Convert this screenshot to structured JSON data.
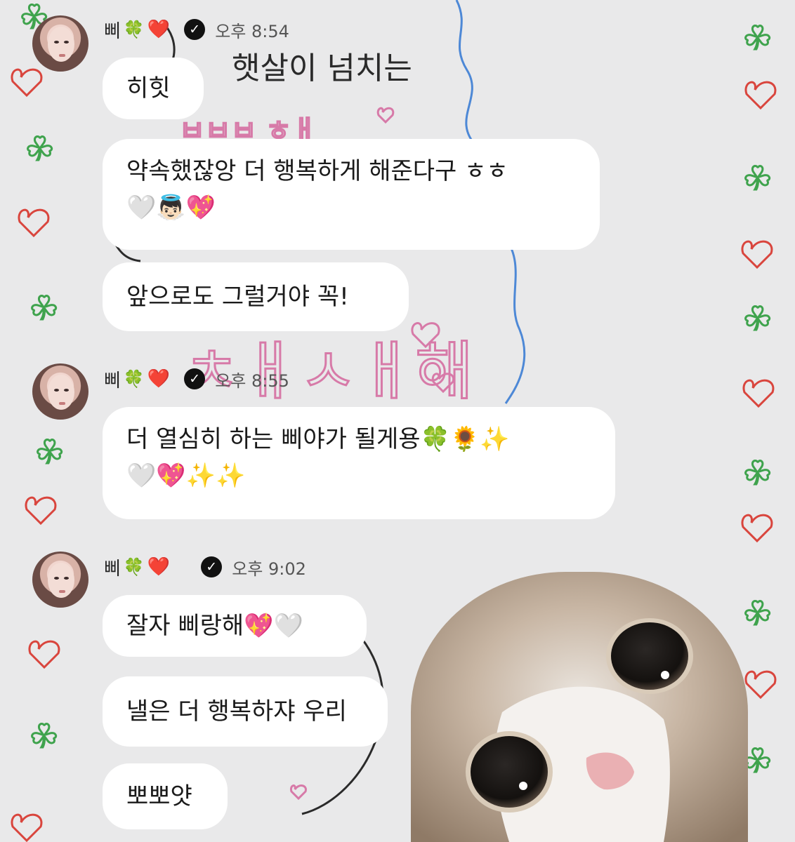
{
  "sender": {
    "name": "삐",
    "clover_icon": "🍀",
    "heart_icon": "❤️"
  },
  "groups": [
    {
      "time": "오후 8:54",
      "messages": [
        {
          "lines": [
            "히힛"
          ]
        },
        {
          "lines": [
            "약속했잖앙 더 행복하게 해준다구 ㅎㅎ",
            "🤍👼🏻💖"
          ]
        },
        {
          "lines": [
            "앞으로도 그럴거야 꼭!"
          ]
        }
      ]
    },
    {
      "time": "오후 8:55",
      "messages": [
        {
          "lines": [
            "더 열심히 하는 삐야가 될게용🍀🌻✨",
            "🤍💖✨✨"
          ]
        }
      ]
    },
    {
      "time": "오후 9:02",
      "messages": [
        {
          "lines": [
            "잘자 삐랑해💖🤍"
          ]
        },
        {
          "lines": [
            "낼은 더 행복하쟈 우리"
          ]
        },
        {
          "lines": [
            "뽀뽀얏"
          ]
        }
      ]
    }
  ],
  "wallpaper": {
    "handwritten_lines": [
      "햇살이 넘치는"
    ]
  },
  "colors": {
    "bubble": "#ffffff",
    "background": "#e9e9ea",
    "doodle_green": "#3fa34d",
    "doodle_red": "#d9453d",
    "doodle_pink": "#d77aa8",
    "doodle_blue": "#4d88d6"
  }
}
